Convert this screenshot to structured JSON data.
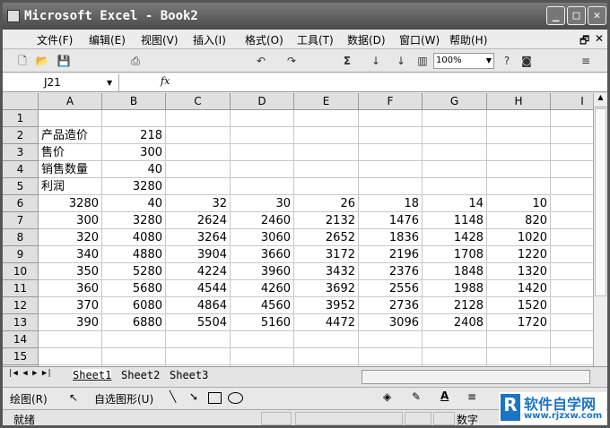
{
  "title": "Microsoft Excel - Book2",
  "menu": [
    "文件(F)",
    "编辑(E)",
    "视图(V)",
    "插入(I)",
    "格式(O)",
    "工具(T)",
    "数据(D)",
    "窗口(W)",
    "帮助(H)"
  ],
  "toolbar": {
    "zoom": "100%"
  },
  "formula": {
    "name_box": "J21",
    "fx": "fx",
    "value": ""
  },
  "columns": [
    "A",
    "B",
    "C",
    "D",
    "E",
    "F",
    "G",
    "H",
    "I"
  ],
  "rows": [
    [
      "",
      "",
      "",
      "",
      "",
      "",
      "",
      "",
      ""
    ],
    [
      "产品造价",
      "218",
      "",
      "",
      "",
      "",
      "",
      "",
      ""
    ],
    [
      "售价",
      "300",
      "",
      "",
      "",
      "",
      "",
      "",
      ""
    ],
    [
      "销售数量",
      "40",
      "",
      "",
      "",
      "",
      "",
      "",
      ""
    ],
    [
      "利润",
      "3280",
      "",
      "",
      "",
      "",
      "",
      "",
      ""
    ],
    [
      "3280",
      "40",
      "32",
      "30",
      "26",
      "18",
      "14",
      "10",
      ""
    ],
    [
      "300",
      "3280",
      "2624",
      "2460",
      "2132",
      "1476",
      "1148",
      "820",
      ""
    ],
    [
      "320",
      "4080",
      "3264",
      "3060",
      "2652",
      "1836",
      "1428",
      "1020",
      ""
    ],
    [
      "340",
      "4880",
      "3904",
      "3660",
      "3172",
      "2196",
      "1708",
      "1220",
      ""
    ],
    [
      "350",
      "5280",
      "4224",
      "3960",
      "3432",
      "2376",
      "1848",
      "1320",
      ""
    ],
    [
      "360",
      "5680",
      "4544",
      "4260",
      "3692",
      "2556",
      "1988",
      "1420",
      ""
    ],
    [
      "370",
      "6080",
      "4864",
      "4560",
      "3952",
      "2736",
      "2128",
      "1520",
      ""
    ],
    [
      "390",
      "6880",
      "5504",
      "5160",
      "4472",
      "3096",
      "2408",
      "1720",
      ""
    ],
    [
      "",
      "",
      "",
      "",
      "",
      "",
      "",
      "",
      ""
    ],
    [
      "",
      "",
      "",
      "",
      "",
      "",
      "",
      "",
      ""
    ],
    [
      "",
      "",
      "",
      "",
      "",
      "",
      "",
      "",
      ""
    ]
  ],
  "sheets": [
    "Sheet1",
    "Sheet2",
    "Sheet3"
  ],
  "drawing": {
    "draw": "绘图(R)",
    "autoshapes": "自选图形(U)"
  },
  "status": {
    "left": "就绪",
    "num": "数字"
  },
  "watermark": {
    "brand": "软件自学网",
    "url": "www.rjzxw.com"
  }
}
